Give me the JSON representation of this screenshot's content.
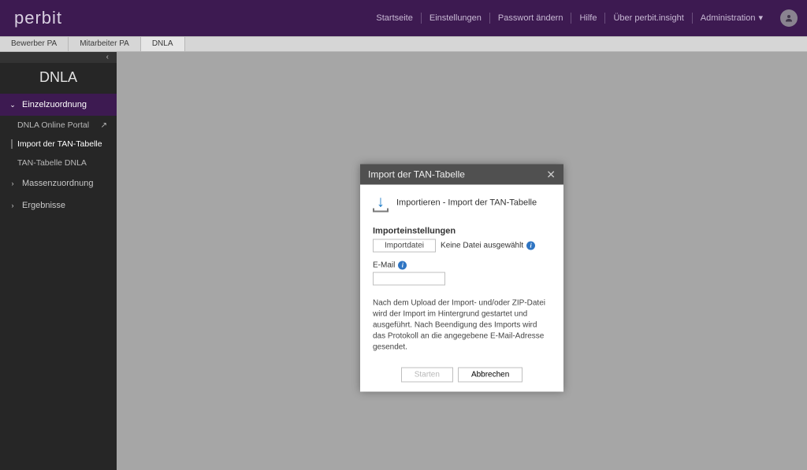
{
  "header": {
    "logo": "perbit",
    "nav": {
      "start": "Startseite",
      "settings": "Einstellungen",
      "password": "Passwort ändern",
      "help": "Hilfe",
      "about": "Über perbit.insight",
      "admin": "Administration"
    }
  },
  "breadcrumbs": {
    "b0": "Bewerber PA",
    "b1": "Mitarbeiter PA",
    "b2": "DNLA"
  },
  "sidebar": {
    "title": "DNLA",
    "groups": {
      "g0": {
        "label": "Einzelzuordnung"
      },
      "g1": {
        "label": "Massenzuordnung"
      },
      "g2": {
        "label": "Ergebnisse"
      }
    },
    "subs": {
      "s0": "DNLA Online Portal",
      "s1": "Import der TAN-Tabelle",
      "s2": "TAN-Tabelle DNLA"
    }
  },
  "modal": {
    "title": "Import der TAN-Tabelle",
    "heading": "Importieren - Import der TAN-Tabelle",
    "section_label": "Importeinstellungen",
    "file_button": "Importdatei",
    "file_status": "Keine Datei ausgewählt",
    "email_label": "E-Mail",
    "description": "Nach dem Upload der Import- und/oder ZIP-Datei wird der Import im Hintergrund gestartet und ausgeführt. Nach Beendigung des Imports wird das Protokoll an die angegebene E-Mail-Adresse gesendet.",
    "start": "Starten",
    "cancel": "Abbrechen"
  }
}
